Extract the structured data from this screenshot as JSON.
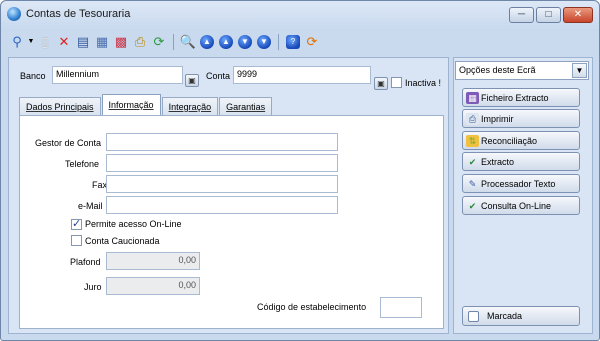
{
  "window": {
    "title": "Contas de Tesouraria"
  },
  "toolbar": {
    "icons": [
      "search-icon",
      "new-document-icon",
      "delete-icon",
      "properties-icon",
      "grid-icon",
      "export-icon",
      "print-icon",
      "refresh-icon",
      "preview-icon",
      "first-icon",
      "previous-icon",
      "next-icon",
      "last-icon",
      "help-icon",
      "close-app-icon"
    ]
  },
  "header": {
    "banco_label": "Banco",
    "banco_value": "Millennium",
    "conta_label": "Conta",
    "conta_value": "9999",
    "inactiva_label": "Inactiva !"
  },
  "tabs": [
    {
      "label": "Dados Principais"
    },
    {
      "label": "Informação"
    },
    {
      "label": "Integração"
    },
    {
      "label": "Garantias"
    }
  ],
  "form": {
    "gestor_label": "Gestor de Conta",
    "gestor_value": "",
    "telefone_label": "Telefone",
    "telefone_value": "",
    "fax_label": "Fax",
    "fax_value": "",
    "email_label": "e-Mail",
    "email_value": "",
    "online_label": "Permite acesso On-Line",
    "online_checked": true,
    "caucionada_label": "Conta Caucionada",
    "caucionada_checked": false,
    "plafond_label": "Plafond",
    "plafond_value": "0,00",
    "juro_label": "Juro",
    "juro_value": "0,00",
    "codigo_label": "Código de estabelecimento",
    "codigo_value": ""
  },
  "options": {
    "select_value": "Opções deste Ecrã",
    "buttons": [
      {
        "label": "Ficheiro Extracto",
        "icon": "file-extract-icon"
      },
      {
        "label": "Imprimir",
        "icon": "print-icon"
      },
      {
        "label": "Reconciliação",
        "icon": "reconcile-icon"
      },
      {
        "label": "Extracto",
        "icon": "extract-icon"
      },
      {
        "label": "Processador Texto",
        "icon": "text-editor-icon"
      },
      {
        "label": "Consulta On-Line",
        "icon": "online-query-icon"
      }
    ],
    "marcada_label": "Marcada"
  }
}
